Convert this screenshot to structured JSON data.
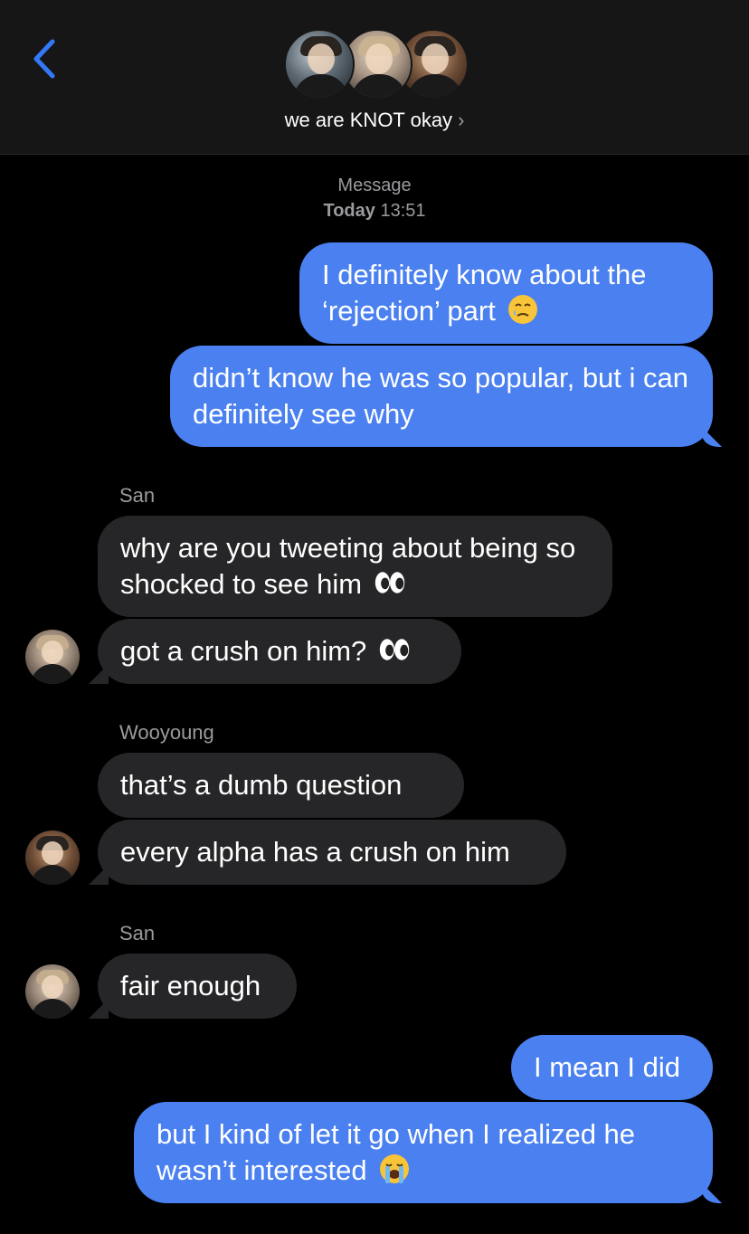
{
  "header": {
    "group_name": "we are KNOT okay",
    "chevron": "›",
    "back_icon": "chevron-left-icon",
    "avatar_count": 3
  },
  "timestamp": {
    "label": "Message",
    "day": "Today",
    "time": "13:51"
  },
  "messages": [
    {
      "from": "me",
      "text": "I definitely know about the ‘rejection’ part",
      "emoji": "face-holding-back-tears"
    },
    {
      "from": "me",
      "text": "didn’t know he was so popular, but i can definitely see why"
    },
    {
      "from": "San",
      "sender_label": "San",
      "text": "why are you tweeting about being so shocked to see him",
      "emoji": "eyes"
    },
    {
      "from": "San",
      "text": "got a crush on him?",
      "emoji": "eyes"
    },
    {
      "from": "Wooyoung",
      "sender_label": "Wooyoung",
      "text": "that’s a dumb question"
    },
    {
      "from": "Wooyoung",
      "text": "every alpha has a crush on him"
    },
    {
      "from": "San",
      "sender_label": "San",
      "text": "fair enough"
    },
    {
      "from": "me",
      "text": "I mean I did"
    },
    {
      "from": "me",
      "text": "but I kind of let it go when I realized he wasn’t interested",
      "emoji": "loudly-crying-face"
    }
  ],
  "colors": {
    "outgoing": "#4a80ef",
    "incoming": "#262628",
    "accent": "#3478f6"
  }
}
